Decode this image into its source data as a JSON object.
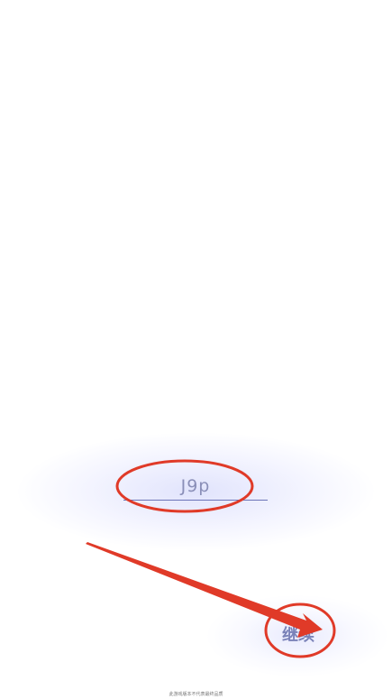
{
  "name_input": {
    "value": "J9p"
  },
  "continue_button": {
    "label": "继续"
  },
  "footer": {
    "hint": "此游戏版本不代表最终品质"
  },
  "colors": {
    "accent": "#6c74b8",
    "annotation": "#e03a28",
    "glow": "#d6d9fb"
  }
}
